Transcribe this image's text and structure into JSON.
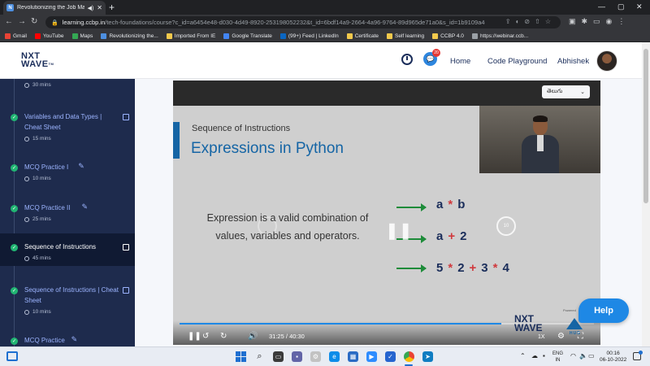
{
  "browser": {
    "tab_title": "Revolutionizing the Job Mark",
    "url_host": "learning.ccbp.in",
    "url_path": "/tech-foundations/course?c_id=a6454e48-d030-4d49-8920-253198052232&t_id=6bdf14a9-2664-4a96-9764-89d965de71a0&s_id=1b9109a4-3...",
    "bookmarks": [
      {
        "label": "Gmail",
        "color": "#ea4335"
      },
      {
        "label": "YouTube",
        "color": "#ff0000"
      },
      {
        "label": "Maps",
        "color": "#34a853"
      },
      {
        "label": "Revolutionizing the...",
        "color": "#4d8fe0"
      },
      {
        "label": "Imported From IE",
        "color": "#f2c94c"
      },
      {
        "label": "Google Translate",
        "color": "#4285f4"
      },
      {
        "label": "(99+) Feed | LinkedIn",
        "color": "#0a66c2"
      },
      {
        "label": "Certificate",
        "color": "#f2c94c"
      },
      {
        "label": "Self learning",
        "color": "#f2c94c"
      },
      {
        "label": "CCBP 4.0",
        "color": "#f2c94c"
      },
      {
        "label": "https://webinar.ccb...",
        "color": "#9aa0a6"
      }
    ]
  },
  "header": {
    "logo_line1": "NXT",
    "logo_line2": "WAVE",
    "logo_tm": "TM",
    "chat_badge": "20",
    "nav_home": "Home",
    "nav_playground": "Code Playground",
    "user_name": "Abhishek"
  },
  "sidebar": {
    "items": [
      {
        "title": "",
        "duration": "30 mins",
        "kind": "reading",
        "active": false
      },
      {
        "title": "Variables and Data Types | Cheat Sheet",
        "duration": "15 mins",
        "kind": "reading",
        "active": false
      },
      {
        "title": "MCQ Practice I",
        "duration": "10 mins",
        "kind": "practice",
        "active": false
      },
      {
        "title": "MCQ Practice II",
        "duration": "25 mins",
        "kind": "practice",
        "active": false
      },
      {
        "title": "Sequence of Instructions",
        "duration": "45 mins",
        "kind": "reading",
        "active": true
      },
      {
        "title": "Sequence of Instructions | Cheat Sheet",
        "duration": "10 mins",
        "kind": "reading",
        "active": false
      },
      {
        "title": "MCQ Practice",
        "duration": "",
        "kind": "practice",
        "active": false
      }
    ]
  },
  "player": {
    "language": "తెలుగు",
    "slide_subtitle": "Sequence of Instructions",
    "slide_title": "Expressions in Python",
    "expression_text": "Expression is a valid combination of values, variables and operators.",
    "expr1": {
      "a": "a",
      "op": "*",
      "b": "b"
    },
    "expr2": {
      "a": "a",
      "op": "+",
      "b": "2"
    },
    "expr3": {
      "t1": "5",
      "o1": "*",
      "t2": "2",
      "o2": "+",
      "t3": "3",
      "o3": "*",
      "t4": "4"
    },
    "current_time": "31:25",
    "total_time": "40:30",
    "time_separator": "/",
    "progress": 0.776,
    "speed": "1X",
    "watermark_line1": "NXT",
    "watermark_line2": "WAVE",
    "powered_by": "Powered",
    "hub_label": "HUB"
  },
  "help_label": "Help",
  "taskbar": {
    "lang_line1": "ENG",
    "lang_line2": "IN",
    "time": "00:16",
    "date": "06-10-2022"
  },
  "colors": {
    "sidebar_bg": "#1e2b4d",
    "accent_blue": "#1565a5",
    "arrow_green": "#1e8c3a",
    "operator_red": "#d0393d",
    "help_blue": "#1e88e5",
    "check_green": "#21b573"
  }
}
